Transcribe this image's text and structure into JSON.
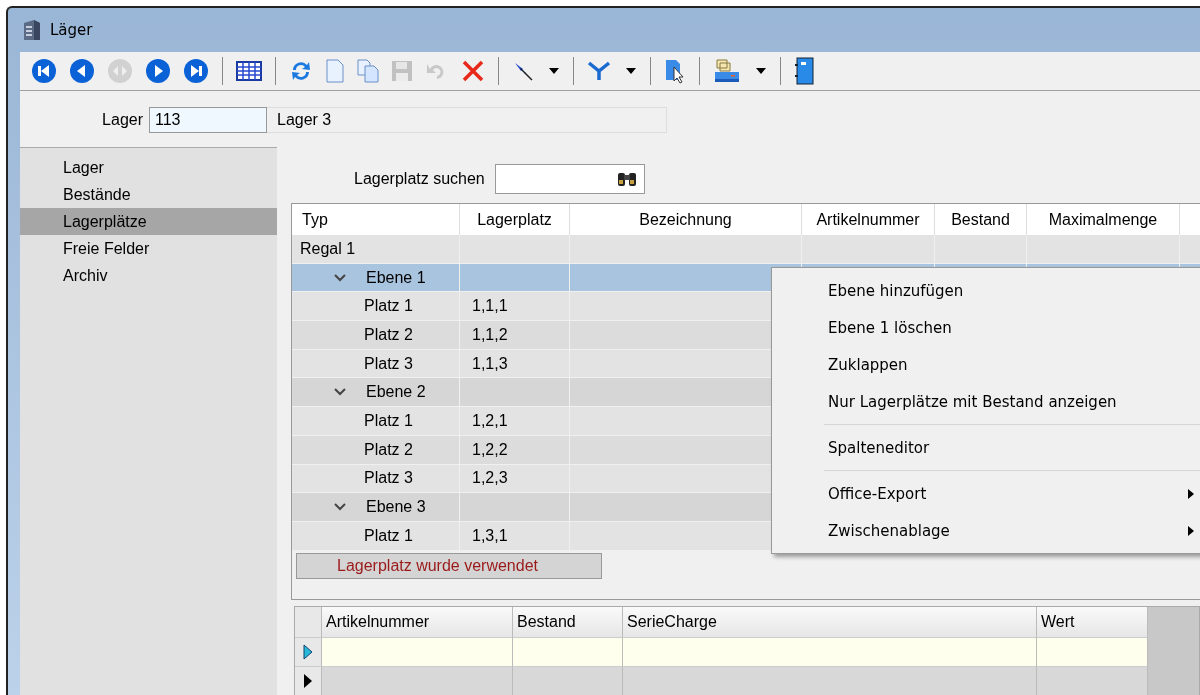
{
  "window": {
    "title": "Läger"
  },
  "toolbar": [
    {
      "kind": "first",
      "disabled": false
    },
    {
      "kind": "prev",
      "disabled": false
    },
    {
      "kind": "center",
      "disabled": true
    },
    {
      "kind": "next",
      "disabled": false
    },
    {
      "kind": "last",
      "disabled": false
    },
    {
      "kind": "separator"
    },
    {
      "kind": "table",
      "disabled": false
    },
    {
      "kind": "separator"
    },
    {
      "kind": "refresh",
      "disabled": false
    },
    {
      "kind": "new",
      "disabled": false
    },
    {
      "kind": "copy",
      "disabled": false
    },
    {
      "kind": "save",
      "disabled": true
    },
    {
      "kind": "undo",
      "disabled": true
    },
    {
      "kind": "delete",
      "disabled": false
    },
    {
      "kind": "separator"
    },
    {
      "kind": "pin",
      "disabled": false,
      "dropdown": true
    },
    {
      "kind": "separator"
    },
    {
      "kind": "filter",
      "disabled": false,
      "dropdown": true
    },
    {
      "kind": "separator"
    },
    {
      "kind": "pointer",
      "disabled": false
    },
    {
      "kind": "separator"
    },
    {
      "kind": "print",
      "disabled": false,
      "dropdown": true
    },
    {
      "kind": "separator"
    },
    {
      "kind": "book",
      "disabled": false
    }
  ],
  "record": {
    "label": "Lager",
    "value": "113",
    "description": "Lager 3"
  },
  "sidebar": {
    "items": [
      {
        "label": "Lager",
        "selected": false
      },
      {
        "label": "Bestände",
        "selected": false
      },
      {
        "label": "Lagerplätze",
        "selected": true
      },
      {
        "label": "Freie Felder",
        "selected": false
      },
      {
        "label": "Archiv",
        "selected": false
      }
    ]
  },
  "search": {
    "label": "Lagerplatz suchen"
  },
  "table": {
    "columns": [
      "Typ",
      "Lagerplatz",
      "Bezeichnung",
      "Artikelnummer",
      "Bestand",
      "Maximalmenge"
    ],
    "rows": [
      {
        "typ": "Regal 1",
        "selected": false,
        "children": [
          {
            "typ": "Ebene 1",
            "expanded": true,
            "selected": true,
            "children": [
              {
                "typ": "Platz 1",
                "lagerplatz": "1,1,1",
                "selected": false
              },
              {
                "typ": "Platz 2",
                "lagerplatz": "1,1,2",
                "selected": false
              },
              {
                "typ": "Platz 3",
                "lagerplatz": "1,1,3",
                "selected": false
              }
            ]
          },
          {
            "typ": "Ebene 2",
            "expanded": true,
            "selected": false,
            "children": [
              {
                "typ": "Platz 1",
                "lagerplatz": "1,2,1",
                "selected": false
              },
              {
                "typ": "Platz 2",
                "lagerplatz": "1,2,2",
                "selected": false
              },
              {
                "typ": "Platz 3",
                "lagerplatz": "1,2,3",
                "selected": false
              }
            ]
          },
          {
            "typ": "Ebene 3",
            "expanded": true,
            "selected": false,
            "children": [
              {
                "typ": "Platz 1",
                "lagerplatz": "1,3,1",
                "selected": false
              }
            ]
          }
        ]
      }
    ]
  },
  "legend": "Lagerplatz wurde verwendet",
  "context_menu": [
    {
      "kind": "item",
      "label": "Ebene hinzufügen",
      "submenu": false
    },
    {
      "kind": "item",
      "label": "Ebene 1 löschen",
      "submenu": false
    },
    {
      "kind": "item",
      "label": "Zuklappen",
      "submenu": false
    },
    {
      "kind": "item",
      "label": "Nur Lagerplätze mit Bestand anzeigen",
      "submenu": false
    },
    {
      "kind": "separator"
    },
    {
      "kind": "item",
      "label": "Spalteneditor",
      "submenu": false
    },
    {
      "kind": "separator"
    },
    {
      "kind": "item",
      "label": "Office-Export",
      "submenu": true
    },
    {
      "kind": "item",
      "label": "Zwischenablage",
      "submenu": true
    }
  ],
  "detail_table": {
    "columns": [
      "Artikelnummer",
      "Bestand",
      "SerieCharge",
      "Wert"
    ],
    "rows": [
      {
        "current": true
      },
      {
        "current": false
      }
    ]
  }
}
